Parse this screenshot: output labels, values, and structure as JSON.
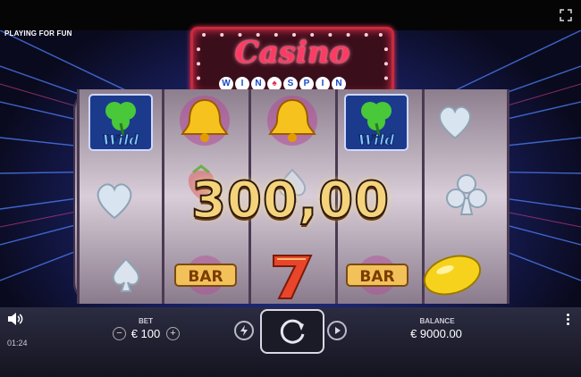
{
  "mode_label": "PLAYING FOR FUN",
  "logo": {
    "title": "Casino",
    "subtitle_letters": [
      "W",
      "I",
      "N",
      "♠",
      "S",
      "P",
      "I",
      "N"
    ]
  },
  "reels": [
    [
      "wild",
      "heart",
      "spade"
    ],
    [
      "bell",
      "strawberry",
      "bar"
    ],
    [
      "bell",
      "spade",
      "seven"
    ],
    [
      "wild",
      "heart",
      "bar"
    ],
    [
      "heart",
      "club",
      "lemon"
    ]
  ],
  "win_amount": "300,00",
  "bet": {
    "label": "BET",
    "value": "€ 100",
    "minus": "−",
    "plus": "+"
  },
  "balance": {
    "label": "BALANCE",
    "value": "€ 9000.00"
  },
  "clock": "01:24",
  "icons": {
    "sound": "speaker-icon",
    "fullscreen": "fullscreen-icon",
    "turbo": "lightning-icon",
    "spin": "spin-arrow-icon",
    "autoplay": "play-icon",
    "menu": "more-vertical-icon"
  },
  "colors": {
    "sign_neon": "#ff3a63",
    "win_gold": "#f5d37a",
    "background_blue": "#1e3cc8"
  }
}
